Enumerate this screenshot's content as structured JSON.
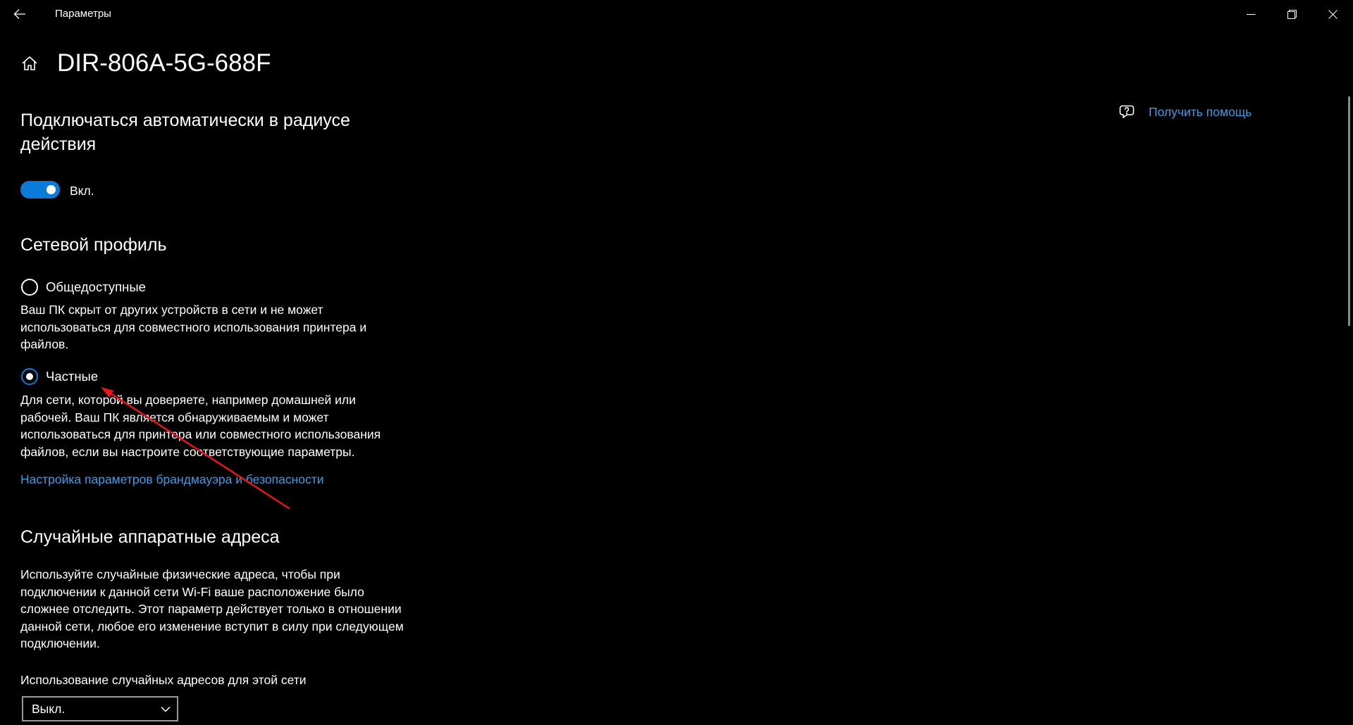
{
  "window": {
    "title": "Параметры"
  },
  "page": {
    "title": "DIR-806A-5G-688F"
  },
  "help": {
    "label": "Получить помощь"
  },
  "auto_connect": {
    "heading_lines": [
      "Подключаться автоматически в радиусе",
      "действия"
    ],
    "toggle_on": true,
    "toggle_label": "Вкл."
  },
  "network_profile": {
    "heading": "Сетевой профиль",
    "options": [
      {
        "label": "Общедоступные",
        "selected": false,
        "description_lines": [
          "Ваш ПК скрыт от других устройств в сети и не может",
          "использоваться для совместного использования принтера и",
          "файлов."
        ]
      },
      {
        "label": "Частные",
        "selected": true,
        "description_lines": [
          "Для сети, которой вы доверяете, например домашней или",
          "рабочей. Ваш ПК является обнаруживаемым и может",
          "использоваться для принтера или совместного использования",
          "файлов, если вы настроите соответствующие параметры."
        ]
      }
    ],
    "firewall_link": "Настройка параметров брандмауэра и безопасности"
  },
  "random_addresses": {
    "heading": "Случайные аппаратные адреса",
    "description_lines": [
      "Используйте случайные физические адреса, чтобы при",
      "подключении к данной сети Wi-Fi ваше расположение было",
      "сложнее отследить. Этот параметр действует только в отношении",
      "данной сети, любое его изменение вступит в силу при следующем",
      "подключении."
    ],
    "setting_label": "Использование случайных адресов для этой сети",
    "dropdown_value": "Выкл."
  },
  "icons": {
    "back": "back-arrow-icon",
    "minimize": "minimize-icon",
    "restore": "restore-icon",
    "close": "close-icon",
    "home": "home-icon",
    "help": "help-chat-icon",
    "dropdown": "chevron-down-icon"
  },
  "colors": {
    "background": "#000000",
    "text": "#ffffff",
    "accent": "#0b7ad8",
    "link": "#429ce3",
    "dropdown_border": "#999999",
    "scrollbar": "#8a8a8a",
    "annotation": "#e8141b"
  }
}
